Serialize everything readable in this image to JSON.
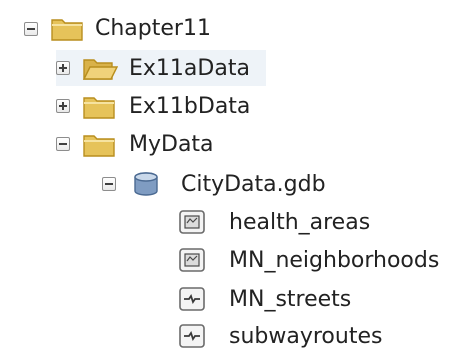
{
  "tree": {
    "items": [
      {
        "label": "Chapter11",
        "kind": "folder",
        "expanded": true
      },
      {
        "label": "Ex11aData",
        "kind": "folder-open",
        "expanded": false
      },
      {
        "label": "Ex11bData",
        "kind": "folder",
        "expanded": false
      },
      {
        "label": "MyData",
        "kind": "folder",
        "expanded": true
      },
      {
        "label": "CityData.gdb",
        "kind": "file-geodatabase",
        "expanded": true
      },
      {
        "label": "health_areas",
        "kind": "polygon-feature-class"
      },
      {
        "label": "MN_neighborhoods",
        "kind": "polygon-feature-class"
      },
      {
        "label": "MN_streets",
        "kind": "line-feature-class"
      },
      {
        "label": "subwayroutes",
        "kind": "line-feature-class"
      }
    ]
  },
  "colors": {
    "folder": "#e6c35a",
    "folder_dark": "#b88e1e",
    "highlight": "#eef3f8",
    "gdb": "#6f8fb8"
  }
}
